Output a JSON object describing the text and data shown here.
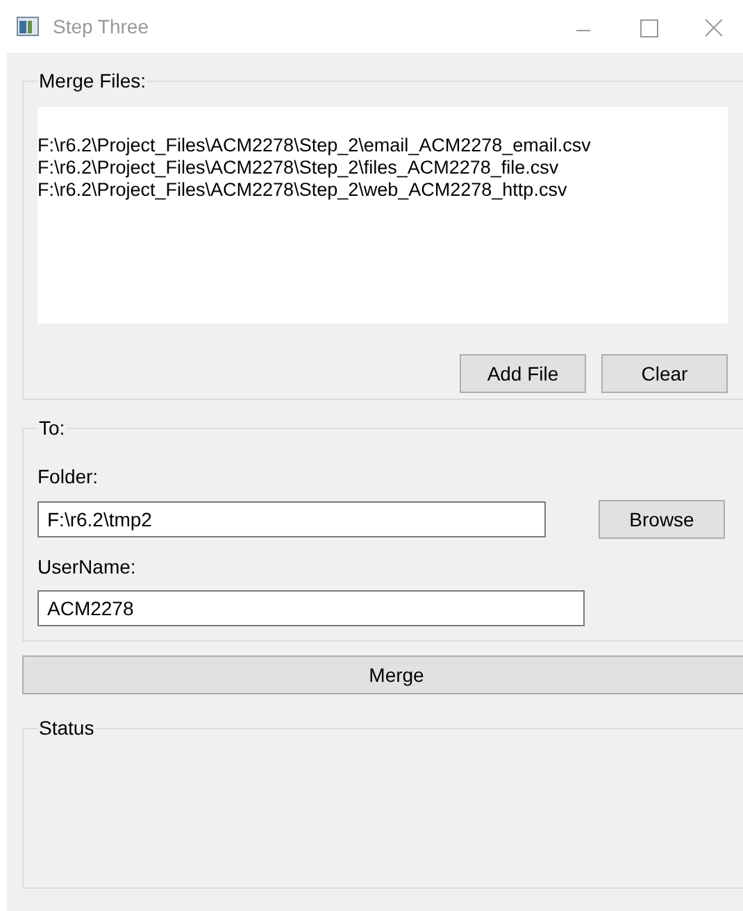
{
  "window": {
    "title": "Step Three"
  },
  "merge_files": {
    "label": "Merge Files:",
    "files": [
      "F:\\r6.2\\Project_Files\\ACM2278\\Step_2\\email_ACM2278_email.csv",
      "F:\\r6.2\\Project_Files\\ACM2278\\Step_2\\files_ACM2278_file.csv",
      "F:\\r6.2\\Project_Files\\ACM2278\\Step_2\\web_ACM2278_http.csv"
    ],
    "buttons": [
      "Add File",
      "Clear"
    ]
  },
  "to": {
    "label": "To:",
    "folder_label": "Folder:",
    "folder_value": "F:\\r6.2\\tmp2",
    "browse_button": "Browse",
    "username_label": "UserName:",
    "username_value": "ACM2278"
  },
  "merge_button": "Merge",
  "status": {
    "label": "Status"
  }
}
